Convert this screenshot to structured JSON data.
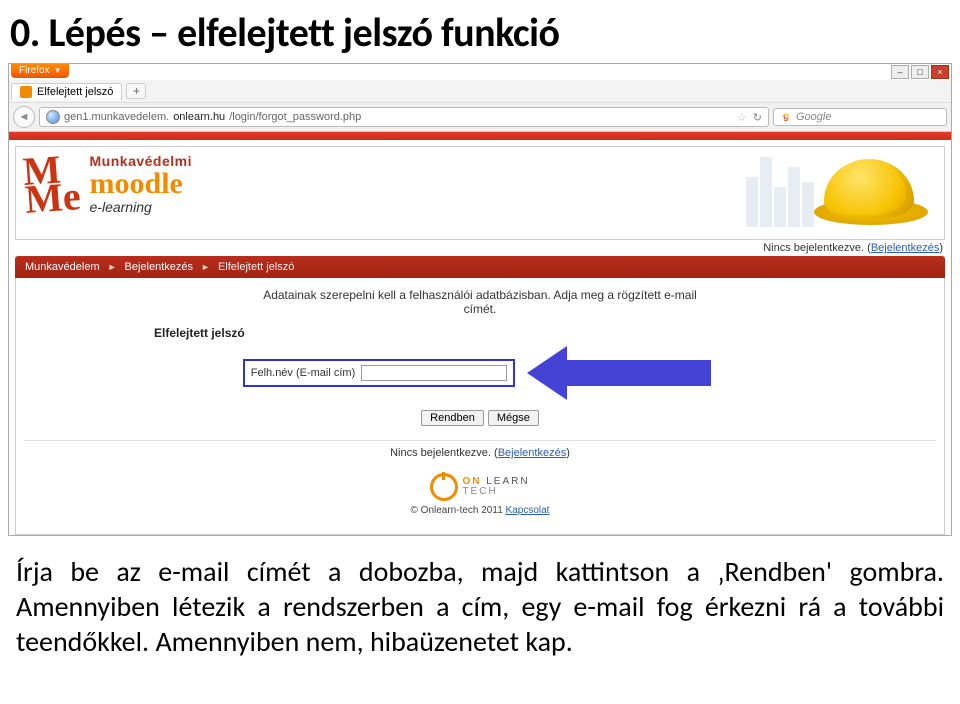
{
  "slide": {
    "title": "0. Lépés – elfelejtett jelszó funkció"
  },
  "browser": {
    "app_button": "Firefox",
    "tab_title": "Elfelejtett jelszó",
    "url_host": "onlearn.hu",
    "url_prefix": "gen1.munkavedelem.",
    "url_path": "/login/forgot_password.php",
    "search_placeholder": "Google"
  },
  "page": {
    "brand_line1": "Munkavédelmi",
    "brand_line2": "moodle",
    "brand_line3": "e-learning",
    "login_status": "Nincs bejelentkezve.",
    "login_link": "Bejelentkezés",
    "breadcrumb": {
      "a": "Munkavédelem",
      "b": "Bejelentkezés",
      "c": "Elfelejtett jelszó"
    },
    "intro": "Adatainak szerepelni kell a felhasználói adatbázisban. Adja meg a rögzített e-mail címét.",
    "legend": "Elfelejtett jelszó",
    "field_label": "Felh.név (E-mail cím)",
    "btn_ok": "Rendben",
    "btn_cancel": "Mégse",
    "footer_copy": "© Onlearn-tech 2011",
    "footer_link": "Kapcsolat"
  },
  "body_text": {
    "l1": "Írja be az e-mail címét a dobozba, majd kattintson a ‚Rendben'",
    "l2": "gombra. Amennyiben létezik a rendszerben a cím, egy e-mail fog",
    "l3": "érkezni rá a további teendőkkel. Amennyiben nem, hibaüzenetet kap."
  }
}
